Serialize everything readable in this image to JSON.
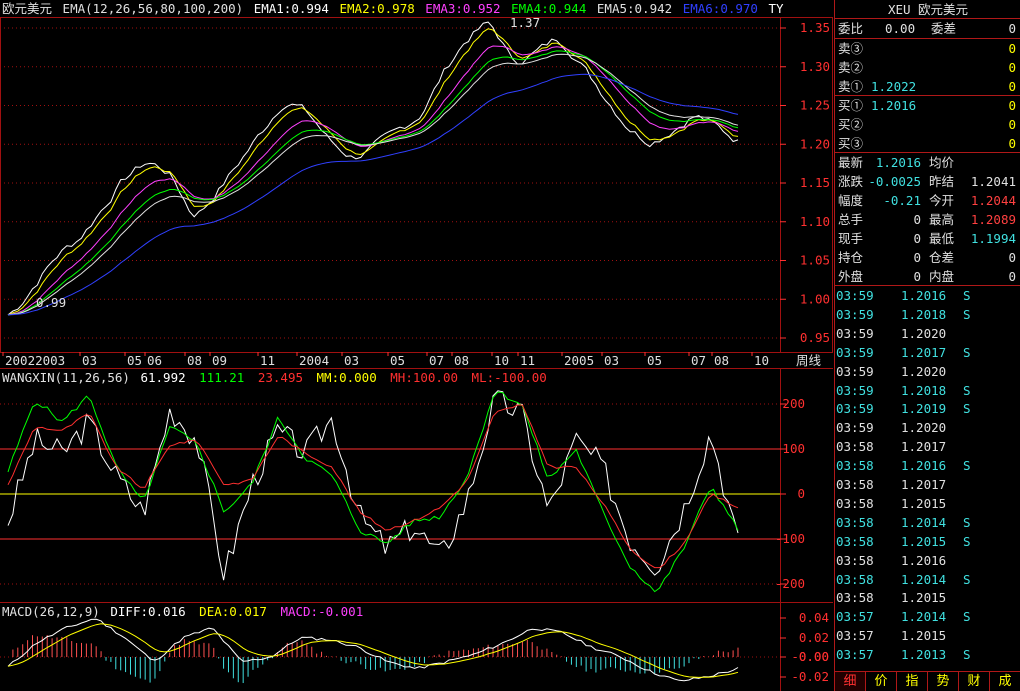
{
  "main_header": {
    "name": "欧元美元",
    "ema_params": "EMA(12,26,56,80,100,200)",
    "ema1": "EMA1:0.994",
    "ema2": "EMA2:0.978",
    "ema3": "EMA3:0.952",
    "ema4": "EMA4:0.944",
    "ema5": "EMA5:0.942",
    "ema6": "EMA6:0.970",
    "ty": "TY"
  },
  "price_axis": [
    "1.35",
    "1.30",
    "1.25",
    "1.20",
    "1.15",
    "1.10",
    "1.05",
    "1.00",
    "0.95"
  ],
  "annotations": {
    "high": "1.37",
    "low": "0.99"
  },
  "date_axis": [
    "20022003",
    "03",
    "05",
    "06",
    "08",
    "09",
    "11",
    "2004",
    "03",
    "05",
    "07",
    "08",
    "10",
    "11",
    "2005",
    "03",
    "05",
    "07",
    "08",
    "10"
  ],
  "period_label": "周线",
  "wangxin_header": {
    "name": "WANGXIN(11,26,56)",
    "v1": "61.992",
    "v2": "111.21",
    "v3": "23.495",
    "mm": "MM:0.000",
    "mh": "MH:100.00",
    "ml": "ML:-100.00"
  },
  "wangxin_axis": [
    "200",
    "100",
    "0",
    "-100",
    "-200"
  ],
  "macd_header": {
    "name": "MACD(26,12,9)",
    "diff": "DIFF:0.016",
    "dea": "DEA:0.017",
    "macd": "MACD:-0.001"
  },
  "macd_axis": [
    "0.04",
    "0.02",
    "0.00",
    "-0.00",
    "-0.02"
  ],
  "colors": {
    "ema1": "#ffffff",
    "ema2": "#ffff00",
    "ema3": "#ff40ff",
    "ema4": "#00ff00",
    "ema5": "#e0e0e0",
    "ema6": "#3040ff",
    "up": "#ff5050",
    "down": "#40e0e0",
    "grid": "#a01010",
    "axis_text": "#ff3030"
  },
  "side": {
    "title": "XEU 欧元美元",
    "weibi_label": "委比",
    "weibi_value": "0.00",
    "weicha_label": "委差",
    "weicha_value": "0",
    "sell": [
      {
        "label": "卖③",
        "price": "",
        "vol": "0"
      },
      {
        "label": "卖②",
        "price": "",
        "vol": "0"
      },
      {
        "label": "卖①",
        "price": "1.2022",
        "vol": "0"
      }
    ],
    "buy": [
      {
        "label": "买①",
        "price": "1.2016",
        "vol": "0"
      },
      {
        "label": "买②",
        "price": "",
        "vol": "0"
      },
      {
        "label": "买③",
        "price": "",
        "vol": "0"
      }
    ],
    "stats": [
      {
        "l1": "最新",
        "v1": "1.2016",
        "l2": "均价",
        "v2": ""
      },
      {
        "l1": "涨跌",
        "v1": "-0.0025",
        "l2": "昨结",
        "v2": "1.2041"
      },
      {
        "l1": "幅度",
        "v1": "-0.21",
        "l2": "今开",
        "v2": "1.2044"
      },
      {
        "l1": "总手",
        "v1": "0",
        "l2": "最高",
        "v2": "1.2089"
      },
      {
        "l1": "现手",
        "v1": "0",
        "l2": "最低",
        "v2": "1.1994"
      },
      {
        "l1": "持仓",
        "v1": "0",
        "l2": "仓差",
        "v2": "0"
      },
      {
        "l1": "外盘",
        "v1": "0",
        "l2": "内盘",
        "v2": "0"
      }
    ],
    "ticks": [
      {
        "time": "03:59",
        "price": "1.2016",
        "flag": "S"
      },
      {
        "time": "03:59",
        "price": "1.2018",
        "flag": "S"
      },
      {
        "time": "03:59",
        "price": "1.2020",
        "flag": ""
      },
      {
        "time": "03:59",
        "price": "1.2017",
        "flag": "S"
      },
      {
        "time": "03:59",
        "price": "1.2020",
        "flag": ""
      },
      {
        "time": "03:59",
        "price": "1.2018",
        "flag": "S"
      },
      {
        "time": "03:59",
        "price": "1.2019",
        "flag": "S"
      },
      {
        "time": "03:59",
        "price": "1.2020",
        "flag": ""
      },
      {
        "time": "03:58",
        "price": "1.2017",
        "flag": ""
      },
      {
        "time": "03:58",
        "price": "1.2016",
        "flag": "S"
      },
      {
        "time": "03:58",
        "price": "1.2017",
        "flag": ""
      },
      {
        "time": "03:58",
        "price": "1.2015",
        "flag": ""
      },
      {
        "time": "03:58",
        "price": "1.2014",
        "flag": "S"
      },
      {
        "time": "03:58",
        "price": "1.2015",
        "flag": "S"
      },
      {
        "time": "03:58",
        "price": "1.2016",
        "flag": ""
      },
      {
        "time": "03:58",
        "price": "1.2014",
        "flag": "S"
      },
      {
        "time": "03:58",
        "price": "1.2015",
        "flag": ""
      },
      {
        "time": "03:57",
        "price": "1.2014",
        "flag": "S"
      },
      {
        "time": "03:57",
        "price": "1.2015",
        "flag": ""
      },
      {
        "time": "03:57",
        "price": "1.2013",
        "flag": "S"
      }
    ],
    "tabs": [
      "细",
      "价",
      "指",
      "势",
      "财",
      "成"
    ]
  }
}
